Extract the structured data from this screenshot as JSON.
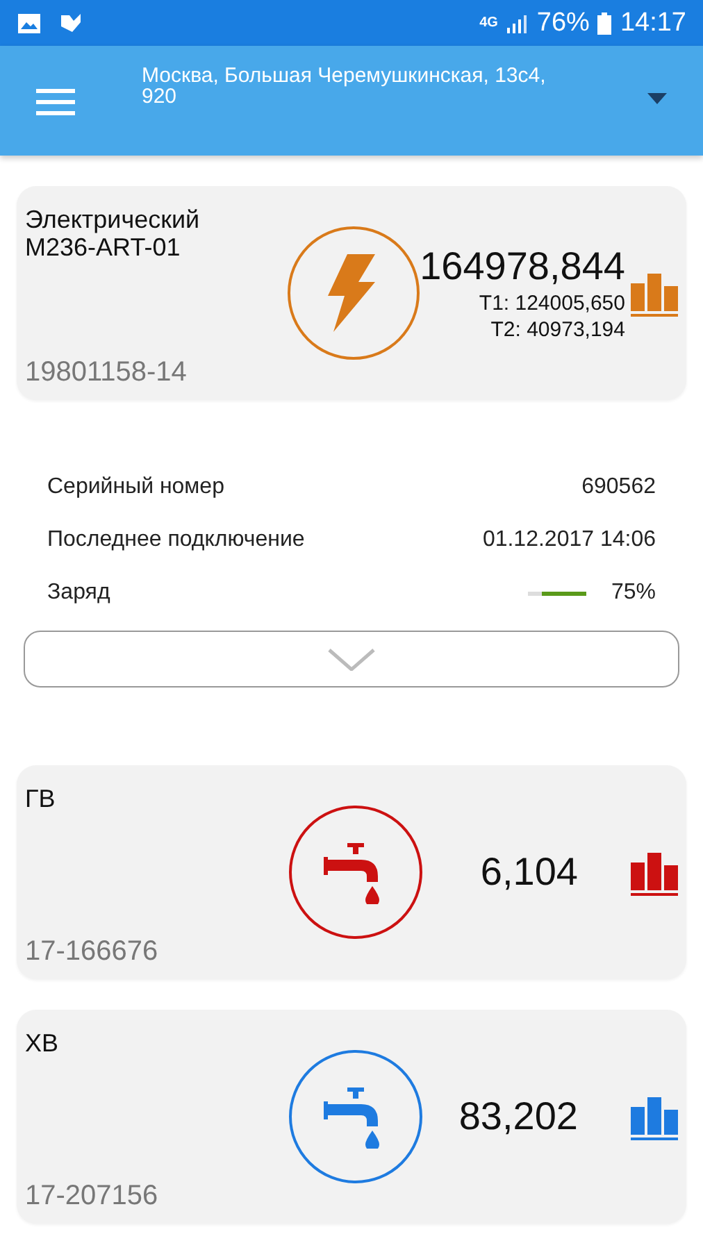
{
  "status_bar": {
    "network": "4G",
    "battery": "76%",
    "time": "14:17"
  },
  "app_bar": {
    "address": "Москва, Большая Черемушкинская, 13с4, 920"
  },
  "meters": [
    {
      "kind": "electric",
      "color": "#d97a1a",
      "name": "Электрический",
      "model": "M236-ART-01",
      "serial": "19801158-14",
      "reading": "164978,844",
      "tariffs": [
        "T1: 124005,650",
        "T2: 40973,194"
      ],
      "details": {
        "rows": [
          {
            "label": "Серийный номер",
            "value": "690562"
          },
          {
            "label": "Последнее подключение",
            "value": "01.12.2017 14:06"
          }
        ],
        "battery": {
          "label": "Заряд",
          "level": 0.75,
          "reading": "75%"
        }
      }
    },
    {
      "kind": "water",
      "color": "#cc1111",
      "name": "ГВ",
      "serial": "17-166676",
      "reading": "6,104"
    },
    {
      "kind": "water",
      "color": "#1e7be0",
      "name": "ХВ",
      "serial": "17-207156",
      "reading": "83,202"
    }
  ]
}
